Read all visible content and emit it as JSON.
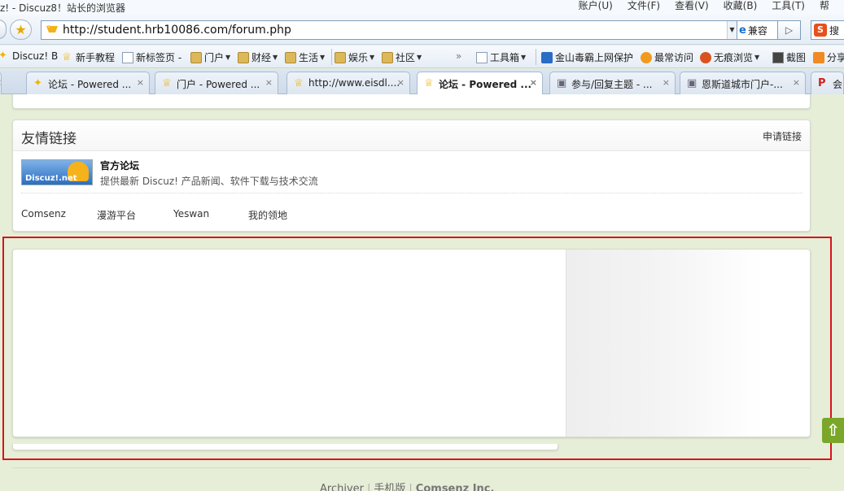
{
  "window": {
    "title": "z! - Discuz8！站长的浏览器"
  },
  "menu": [
    "账户(U)",
    "文件(F)",
    "查看(V)",
    "收藏(B)",
    "工具(T)",
    "帮"
  ],
  "addressbar": {
    "url": "http://student.hrb10086.com/forum.php",
    "compat_label": "兼容",
    "go_glyph": "▷",
    "search_label": "搜"
  },
  "bookmarks": [
    {
      "label": "Discuz! B",
      "icon": "person-icon"
    },
    {
      "label": "新手教程",
      "icon": "cup-icon"
    },
    {
      "label": "新标签页 -",
      "icon": "page-icon"
    },
    {
      "label": "门户",
      "icon": "folder-icon"
    },
    {
      "label": "财经",
      "icon": "folder-icon"
    },
    {
      "label": "生活",
      "icon": "folder-icon"
    },
    {
      "label": "娱乐",
      "icon": "folder-icon"
    },
    {
      "label": "社区",
      "icon": "folder-icon"
    },
    {
      "label": "工具箱",
      "icon": "toolbox-icon"
    },
    {
      "label": "金山毒霸上网保护",
      "icon": "shield-icon"
    },
    {
      "label": "最常访问",
      "icon": "star-icon"
    },
    {
      "label": "无痕浏览",
      "icon": "eye-icon"
    },
    {
      "label": "截图",
      "icon": "crop-icon"
    },
    {
      "label": "分享",
      "icon": "share-icon"
    }
  ],
  "tabs": [
    {
      "label": "论坛 - Powered ...",
      "active": false
    },
    {
      "label": "门户 - Powered ...",
      "active": false
    },
    {
      "label": "http://www.eisdl....",
      "active": false
    },
    {
      "label": "论坛 - Powered ...",
      "active": true
    },
    {
      "label": "参与/回复主题 - ...",
      "active": false
    },
    {
      "label": "恩斯道城市门户-...",
      "active": false
    },
    {
      "label": "会",
      "active": false
    }
  ],
  "friend_links": {
    "title": "友情链接",
    "apply_label": "申请链接",
    "logo_text": "Discuz!.net",
    "featured": {
      "name": "官方论坛",
      "desc": "提供最新 Discuz! 产品新闻、软件下载与技术交流"
    },
    "text_links": [
      "Comsenz",
      "漫游平台",
      "Yeswan",
      "我的领地"
    ]
  },
  "footer": {
    "links": [
      "Archiver",
      "手机版"
    ],
    "company": "Comsenz Inc."
  },
  "colors": {
    "highlight": "#d8141c",
    "page_bg": "#e6eed8",
    "top_button": "#7aa62a"
  }
}
